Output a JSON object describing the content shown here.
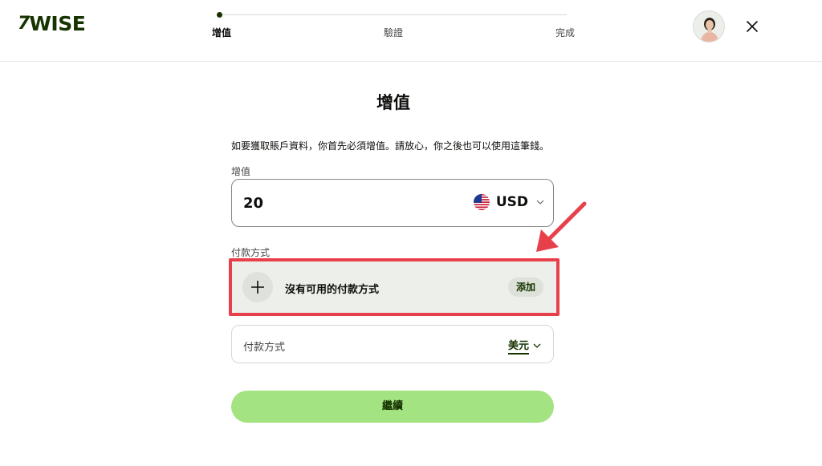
{
  "brand": {
    "logo_mark": "7",
    "logo_text": "WISE",
    "accent": "#163300",
    "button_color": "#a4e382"
  },
  "stepper": {
    "steps": [
      {
        "label": "增值",
        "active": true
      },
      {
        "label": "驗證",
        "active": false
      },
      {
        "label": "完成",
        "active": false
      }
    ]
  },
  "header": {
    "avatar_icon": "user-avatar",
    "close_icon": "close-icon"
  },
  "main": {
    "title": "增值",
    "intro": "如要獲取賬戶資料，你首先必須增值。請放心，你之後也可以使用這筆錢。",
    "amount": {
      "label": "增值",
      "value": "20",
      "currency": "USD",
      "flag_icon": "us-flag-icon"
    },
    "payment": {
      "label": "付款方式",
      "empty_text": "沒有可用的付款方式",
      "add_label": "添加",
      "highlight_color": "#e8404b"
    },
    "method": {
      "label": "付款方式",
      "currency": "美元"
    },
    "continue_label": "繼續"
  }
}
